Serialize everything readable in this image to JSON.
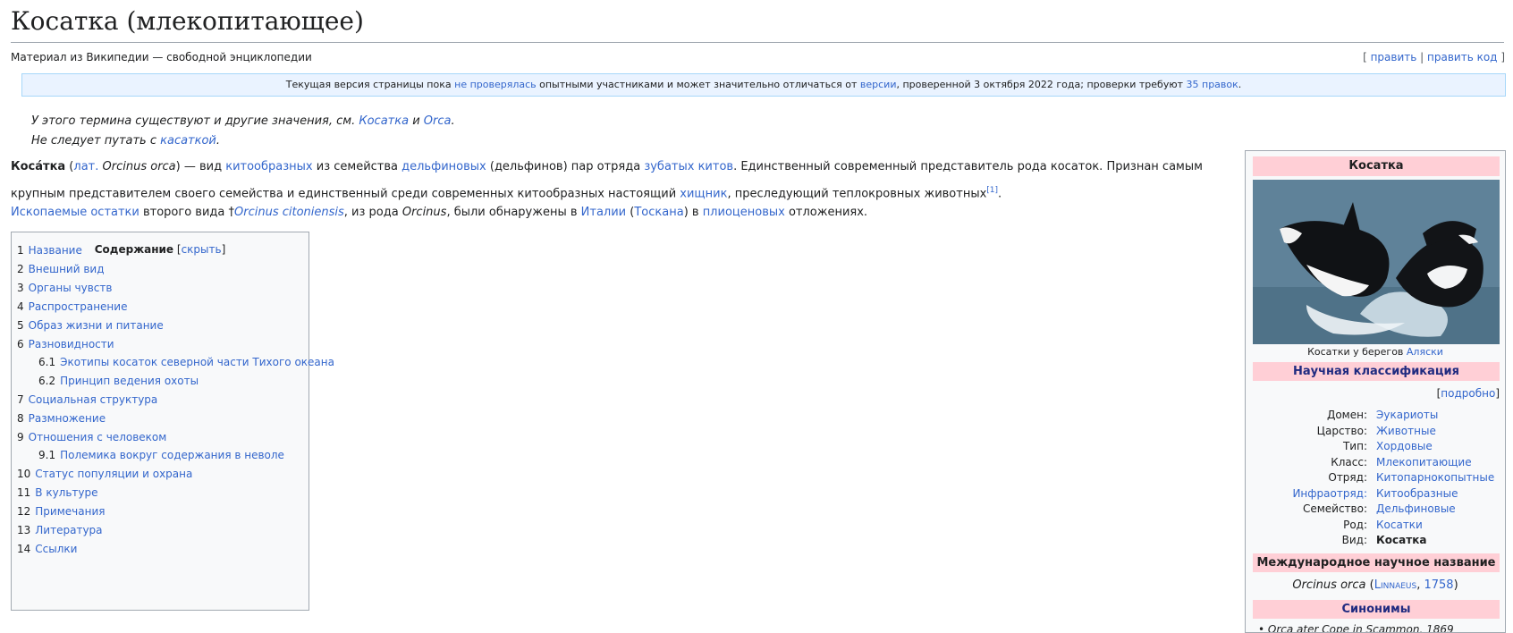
{
  "page": {
    "title": "Косатка (млекопитающее)",
    "tagline": "Материал из Википедии — свободной энциклопедии"
  },
  "edit": {
    "open": "[",
    "edit_label": "править",
    "sep": "|",
    "edit_code_label": "править код",
    "close": "]"
  },
  "flagged": {
    "t1": "Текущая версия страницы пока ",
    "link1": "не проверялась",
    "t2": " опытными участниками и может значительно отличаться от ",
    "link2": "версии",
    "t3": ", проверенной 3 октября 2022 года; проверки требуют ",
    "link3": "35 правок",
    "t4": "."
  },
  "hatnote1": {
    "t1": "У этого термина существуют и другие значения, см. ",
    "link1": "Косатка",
    "t2": " и ",
    "link2": "Orca",
    "t3": "."
  },
  "hatnote2": {
    "t1": "Не следует путать с ",
    "link1": "касаткой",
    "t2": "."
  },
  "lead": {
    "bold": "Коса́тка",
    "p1": " (",
    "lat": "лат.",
    "p2": " ",
    "orca": "Orcinus orca",
    "p3": ") — вид ",
    "l_kito": "китообразных",
    "p4": " из семейства ",
    "l_delf": "дельфиновых",
    "p5": " (дельфинов) пар отряда ",
    "l_zub": "зубатых китов",
    "p6": ". Единственный современный представитель рода косаток. Признан самым крупным представителем своего семейства и единственный среди современных китообразных настоящий ",
    "l_hish": "хищник",
    "p7": ", преследующий теплокровных животных",
    "ref": "[1]",
    "p8": "."
  },
  "fossil": {
    "l_fossil": "Ископаемые остатки",
    "p1": " второго вида ",
    "dagger": "†",
    "l_cit": "Orcinus citoniensis",
    "p2": ", из рода ",
    "genus": "Orcinus",
    "p3": ", были обнаружены в ",
    "l_it": "Италии",
    "p4": " (",
    "l_tosk": "Тоскана",
    "p5": ") в ",
    "l_plio": "плиоценовых",
    "p6": " отложениях."
  },
  "toc": {
    "title": "Содержание",
    "hide_open": " [",
    "hide": "скрыть",
    "hide_close": "]",
    "items": [
      {
        "num": "1",
        "label": "Название"
      },
      {
        "num": "2",
        "label": "Внешний вид"
      },
      {
        "num": "3",
        "label": "Органы чувств"
      },
      {
        "num": "4",
        "label": "Распространение"
      },
      {
        "num": "5",
        "label": "Образ жизни и питание"
      },
      {
        "num": "6",
        "label": "Разновидности"
      },
      {
        "num": "6.1",
        "label": "Экотипы косаток северной части Тихого океана"
      },
      {
        "num": "6.2",
        "label": "Принцип ведения охоты"
      },
      {
        "num": "7",
        "label": "Социальная структура"
      },
      {
        "num": "8",
        "label": "Размножение"
      },
      {
        "num": "9",
        "label": "Отношения с человеком"
      },
      {
        "num": "9.1",
        "label": "Полемика вокруг содержания в неволе"
      },
      {
        "num": "10",
        "label": "Статус популяции и охрана"
      },
      {
        "num": "11",
        "label": "В культуре"
      },
      {
        "num": "12",
        "label": "Примечания"
      },
      {
        "num": "13",
        "label": "Литература"
      },
      {
        "num": "14",
        "label": "Ссылки"
      }
    ]
  },
  "infobox": {
    "title": "Косатка",
    "caption_text": "Косатки у берегов ",
    "caption_link": "Аляски",
    "sci_header": "Научная классификация",
    "podrobno_open": "[",
    "podrobno": "подробно",
    "podrobno_close": "]",
    "rows": [
      {
        "label": "Домен:",
        "value": "Эукариоты"
      },
      {
        "label": "Царство:",
        "value": "Животные"
      },
      {
        "label": "Тип:",
        "value": "Хордовые"
      },
      {
        "label": "Класс:",
        "value": "Млекопитающие"
      },
      {
        "label": "Отряд:",
        "value": "Китопарнокопытные"
      },
      {
        "label": "Инфраотряд:",
        "value": "Китообразные"
      },
      {
        "label": "Семейство:",
        "value": "Дельфиновые"
      },
      {
        "label": "Род:",
        "value": "Косатки"
      },
      {
        "label": "Вид:",
        "value": "Косатка"
      }
    ],
    "intl_header": "Международное научное название",
    "intl_name": "Orcinus orca",
    "intl_p1": " (",
    "intl_author": "Linnaeus",
    "intl_p2": ", ",
    "intl_year": "1758",
    "intl_p3": ")",
    "syn_header": "Синонимы",
    "syn_partial": "Orca ater Cope in Scammon, 1869"
  },
  "colors": {
    "link": "#3366cc",
    "visited": "#795cb2",
    "infobox_header": "#ffcfd6",
    "notice_bg": "#eaf3ff"
  }
}
